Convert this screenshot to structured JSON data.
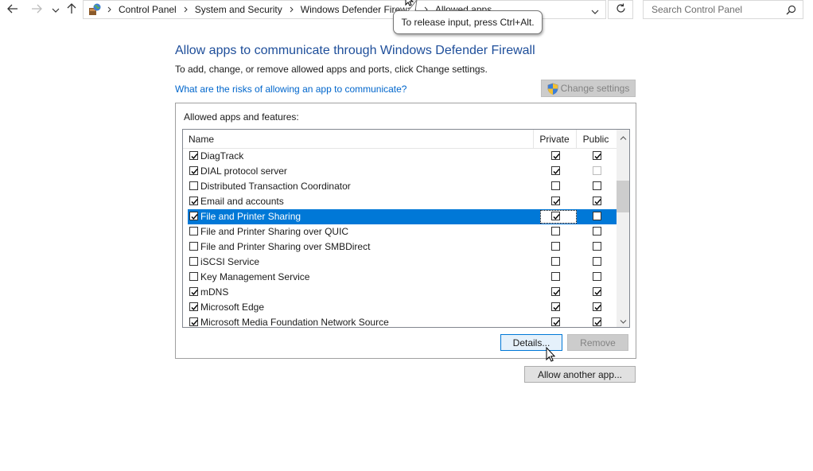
{
  "nav": {
    "back_icon": "arrow-left-icon",
    "forward_icon": "arrow-right-icon",
    "recent_icon": "chevron-down-icon",
    "up_icon": "arrow-up-icon"
  },
  "breadcrumb": {
    "icon": "control-panel-icon",
    "items": [
      "Control Panel",
      "System and Security",
      "Windows Defender Firewall",
      "Allowed apps"
    ]
  },
  "search": {
    "placeholder": "Search Control Panel",
    "icon": "search-icon"
  },
  "tooltip": {
    "text": "To release input, press Ctrl+Alt."
  },
  "page": {
    "title": "Allow apps to communicate through Windows Defender Firewall",
    "subtitle": "To add, change, or remove allowed apps and ports, click Change settings.",
    "risk_link": "What are the risks of allowing an app to communicate?",
    "change_settings": "Change settings"
  },
  "apps": {
    "group_label": "Allowed apps and features:",
    "columns": {
      "name": "Name",
      "private": "Private",
      "public": "Public"
    },
    "rows": [
      {
        "name": "DiagTrack",
        "enabled": true,
        "private": true,
        "public": true
      },
      {
        "name": "DIAL protocol server",
        "enabled": true,
        "private": true,
        "public": false,
        "public_disabled": true
      },
      {
        "name": "Distributed Transaction Coordinator",
        "enabled": false,
        "private": false,
        "public": false
      },
      {
        "name": "Email and accounts",
        "enabled": true,
        "private": true,
        "public": true
      },
      {
        "name": "File and Printer Sharing",
        "enabled": true,
        "private": true,
        "public": false,
        "selected": true
      },
      {
        "name": "File and Printer Sharing over QUIC",
        "enabled": false,
        "private": false,
        "public": false
      },
      {
        "name": "File and Printer Sharing over SMBDirect",
        "enabled": false,
        "private": false,
        "public": false
      },
      {
        "name": "iSCSI Service",
        "enabled": false,
        "private": false,
        "public": false
      },
      {
        "name": "Key Management Service",
        "enabled": false,
        "private": false,
        "public": false
      },
      {
        "name": "mDNS",
        "enabled": true,
        "private": true,
        "public": true
      },
      {
        "name": "Microsoft Edge",
        "enabled": true,
        "private": true,
        "public": true
      },
      {
        "name": "Microsoft Media Foundation Network Source",
        "enabled": true,
        "private": true,
        "public": true
      }
    ],
    "details_button": "Details...",
    "remove_button": "Remove"
  },
  "allow_another": "Allow another app...",
  "colors": {
    "accent": "#0078d7",
    "title": "#1e4e9a",
    "link": "#0066cc"
  }
}
